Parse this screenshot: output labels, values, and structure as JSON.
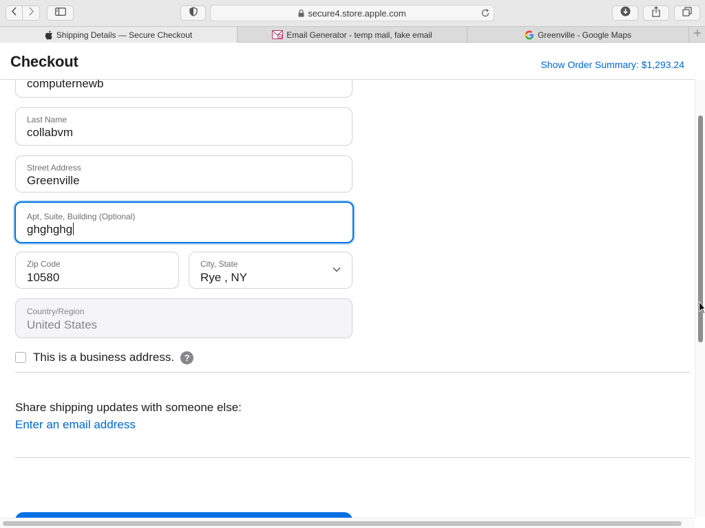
{
  "browser": {
    "url": "secure4.store.apple.com",
    "tabs": [
      {
        "title": "Shipping Details — Secure Checkout",
        "icon": "apple-icon",
        "active": true
      },
      {
        "title": "Email Generator - temp mail, fake email",
        "icon": "email-generator-icon",
        "active": false
      },
      {
        "title": "Greenville - Google Maps",
        "icon": "google-icon",
        "active": false
      }
    ]
  },
  "header": {
    "title": "Checkout",
    "order_summary": "Show Order Summary: $1,293.24"
  },
  "form": {
    "first_name": {
      "value": "computernewb"
    },
    "last_name": {
      "label": "Last Name",
      "value": "collabvm"
    },
    "street": {
      "label": "Street Address",
      "value": "Greenville"
    },
    "apt": {
      "label": "Apt, Suite, Building (Optional)",
      "value": "ghghghg"
    },
    "zip": {
      "label": "Zip Code",
      "value": "10580"
    },
    "city_state": {
      "label": "City, State",
      "value": "Rye , NY"
    },
    "country": {
      "label": "Country/Region",
      "value": "United States"
    },
    "business": {
      "label": "This is a business address.",
      "checked": false,
      "help": "?"
    }
  },
  "share": {
    "title": "Share shipping updates with someone else:",
    "link": "Enter an email address"
  },
  "colors": {
    "accent": "#0071e3",
    "link": "#0066cc",
    "text": "#1d1d1f",
    "muted": "#6e6e73"
  }
}
